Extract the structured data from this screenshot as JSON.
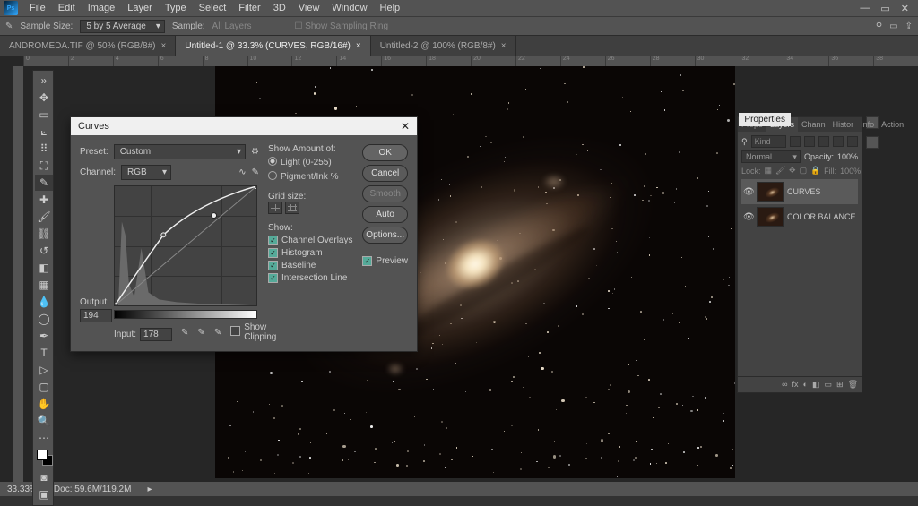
{
  "menu": {
    "items": [
      "File",
      "Edit",
      "Image",
      "Layer",
      "Type",
      "Select",
      "Filter",
      "3D",
      "View",
      "Window",
      "Help"
    ]
  },
  "optionsbar": {
    "sample_label": "Sample Size:",
    "sample_value": "5 by 5 Average",
    "sample2": "Sample:",
    "sample2_value": "All Layers",
    "show_ring": "Show Sampling Ring"
  },
  "doctabs": [
    {
      "label": "ANDROMEDA.TIF @ 50% (RGB/8#)",
      "active": false
    },
    {
      "label": "Untitled-1 @ 33.3% (CURVES, RGB/16#)",
      "active": true
    },
    {
      "label": "Untitled-2 @ 100% (RGB/8#)",
      "active": false
    }
  ],
  "ruler_ticks": [
    "0",
    "2",
    "4",
    "6",
    "8",
    "10",
    "12",
    "14",
    "16",
    "18",
    "20",
    "22",
    "24",
    "26",
    "28",
    "30",
    "32",
    "34",
    "36",
    "38"
  ],
  "curves": {
    "title": "Curves",
    "preset_label": "Preset:",
    "preset_value": "Custom",
    "channel_label": "Channel:",
    "channel_value": "RGB",
    "output_label": "Output:",
    "output_value": "194",
    "input_label": "Input:",
    "input_value": "178",
    "show_clipping": "Show Clipping",
    "show_amount": "Show Amount of:",
    "light_label": "Light  (0-255)",
    "pigment_label": "Pigment/Ink %",
    "grid_label": "Grid size:",
    "show_label": "Show:",
    "opts": {
      "channel_overlays": "Channel Overlays",
      "histogram": "Histogram",
      "baseline": "Baseline",
      "intersection": "Intersection Line"
    },
    "btn": {
      "ok": "OK",
      "cancel": "Cancel",
      "smooth": "Smooth",
      "auto": "Auto",
      "options": "Options..."
    },
    "preview": "Preview"
  },
  "panels": {
    "floater": "Properties",
    "tabs": [
      "Prope",
      "Layers",
      "Chann",
      "Histor",
      "Info",
      "Action"
    ],
    "layers": {
      "kind_placeholder": "Kind",
      "blend": "Normal",
      "opacity_label": "Opacity:",
      "opacity_value": "100%",
      "lock_label": "Lock:",
      "fill_label": "Fill:",
      "fill_value": "100%",
      "rows": [
        {
          "name": "CURVES",
          "sel": true
        },
        {
          "name": "COLOR BALANCE",
          "sel": false
        }
      ],
      "footer_icons": [
        "∞",
        "fx",
        "◐",
        "◧",
        "▭",
        "⊞",
        "🗑"
      ]
    }
  },
  "status": {
    "zoom": "33.33%",
    "doc": "Doc: 59.6M/119.2M"
  }
}
